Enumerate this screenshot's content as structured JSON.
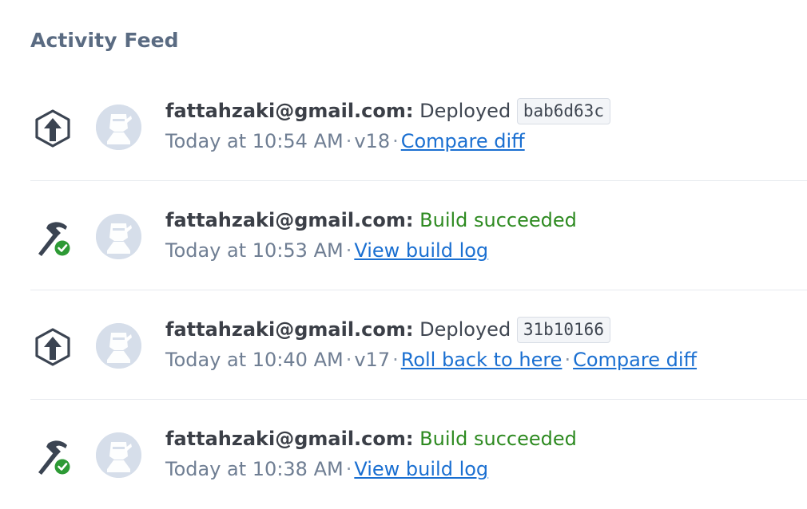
{
  "header": {
    "title": "Activity Feed"
  },
  "colors": {
    "accent_link": "#1a6fd1",
    "success": "#2d8a20",
    "muted": "#6f7e93",
    "icon": "#3b4452"
  },
  "entries": [
    {
      "type_icon": "deploy-icon",
      "user": "fattahzaki@gmail.com:",
      "action": "Deployed",
      "commit": "bab6d63c",
      "time": "Today at 10:54 AM",
      "version": "v18",
      "link_compare": "Compare diff"
    },
    {
      "type_icon": "build-success-icon",
      "user": "fattahzaki@gmail.com:",
      "action": "Build succeeded",
      "time": "Today at 10:53 AM",
      "link_log": "View build log"
    },
    {
      "type_icon": "deploy-icon",
      "user": "fattahzaki@gmail.com:",
      "action": "Deployed",
      "commit": "31b10166",
      "time": "Today at 10:40 AM",
      "version": "v17",
      "link_rollback": "Roll back to here",
      "link_compare": "Compare diff"
    },
    {
      "type_icon": "build-success-icon",
      "user": "fattahzaki@gmail.com:",
      "action": "Build succeeded",
      "time": "Today at 10:38 AM",
      "link_log": "View build log"
    }
  ],
  "separator": "·"
}
